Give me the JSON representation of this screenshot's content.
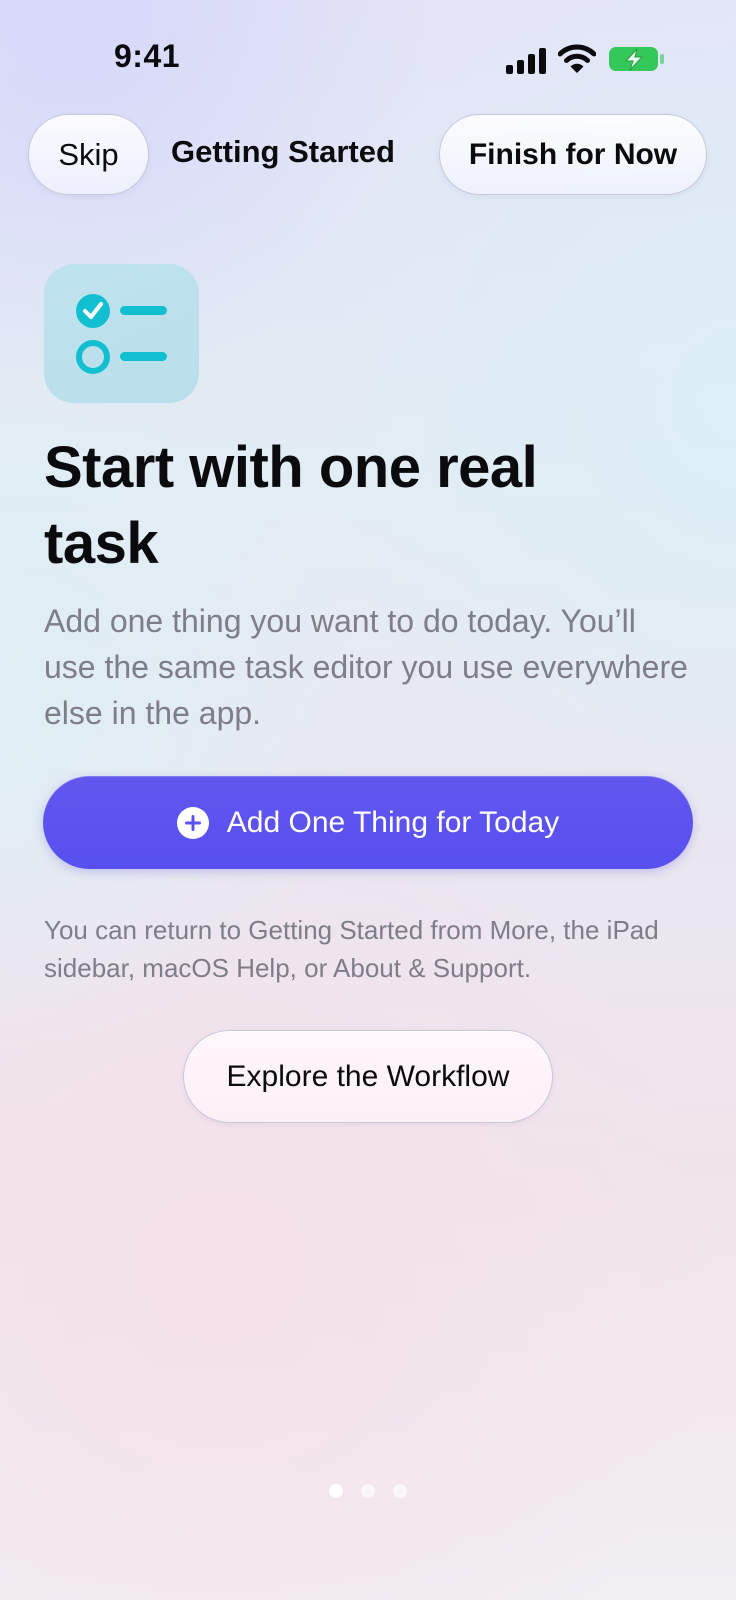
{
  "status_bar": {
    "time": "9:41"
  },
  "header": {
    "skip_label": "Skip",
    "title": "Getting Started",
    "finish_label": "Finish for Now"
  },
  "main": {
    "headline": "Start with one real task",
    "description": "Add one thing you want to do today. You’ll use the same task editor you use everywhere else in the app.",
    "primary_button_label": "Add One Thing for Today",
    "footnote": "You can return to Getting Started from More, the iPad sidebar, macOS Help, or About & Support.",
    "secondary_button_label": "Explore the Workflow"
  },
  "pagination": {
    "total": 3,
    "current": 1
  },
  "icons": {
    "app_icon": "checklist-icon",
    "primary_button_icon": "plus-circle-icon"
  },
  "colors": {
    "accent": "#5b52f0",
    "icon_tint": "#12bfd0",
    "icon_background": "#bde1ec",
    "battery_green": "#34c759"
  }
}
